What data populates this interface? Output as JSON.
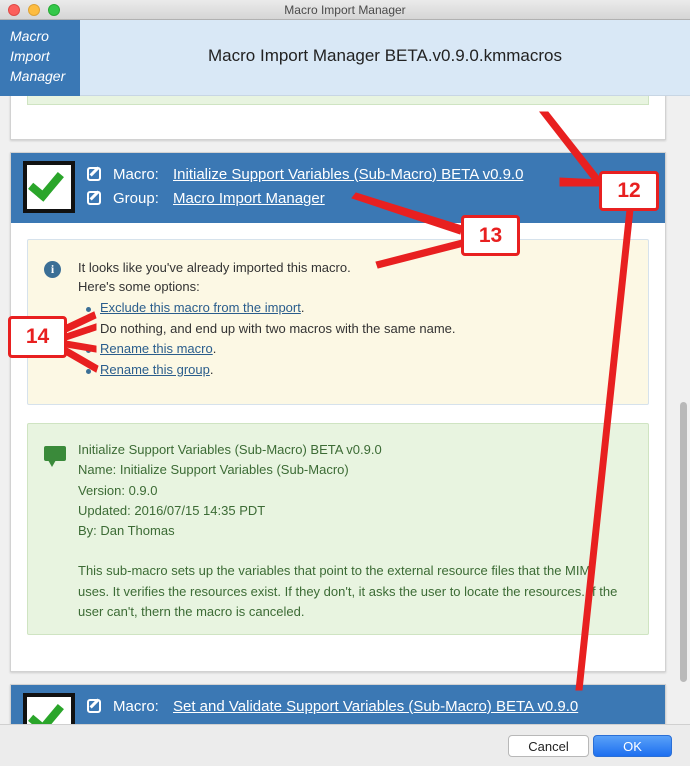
{
  "window": {
    "title": "Macro Import Manager"
  },
  "header": {
    "logo_lines": [
      "Macro",
      "Import",
      "Manager"
    ],
    "title": "Macro Import Manager BETA.v0.9.0.kmmacros"
  },
  "macro_card": {
    "macro_label": "Macro:",
    "macro_name": "Initialize Support Variables (Sub-Macro) BETA v0.9.0",
    "group_label": "Group:",
    "group_name": "Macro Import Manager",
    "warning": {
      "line1": "It looks like you've already imported this macro.",
      "line2": "Here's some options:",
      "options": [
        "Exclude this macro from the import",
        "Do nothing, and end up with two macros with the same name.",
        "Rename this macro",
        "Rename this group"
      ]
    },
    "description": {
      "title": "Initialize Support Variables (Sub-Macro) BETA v0.9.0",
      "name": "Name: Initialize Support Variables (Sub-Macro)",
      "version": "Version: 0.9.0",
      "updated": "Updated: 2016/07/15 14:35 PDT",
      "by": "By: Dan Thomas",
      "body": "This sub-macro sets up the variables that point to the external resource files that the MIM uses. It verifies the resources exist. If they don't, it asks the user to locate the resources. If the user can't, thern the macro is canceled."
    }
  },
  "next_card": {
    "macro_label": "Macro:",
    "macro_name": "Set and Validate Support Variables (Sub-Macro) BETA v0.9.0"
  },
  "footer": {
    "cancel_label": "Cancel",
    "ok_label": "OK"
  },
  "annotations": {
    "callout_12": "12",
    "callout_13": "13",
    "callout_14": "14"
  },
  "colors": {
    "accent": "#3b78b4",
    "annotation": "#e82020",
    "warning_bg": "#fcf8e4",
    "description_bg": "#e8f4e0"
  }
}
